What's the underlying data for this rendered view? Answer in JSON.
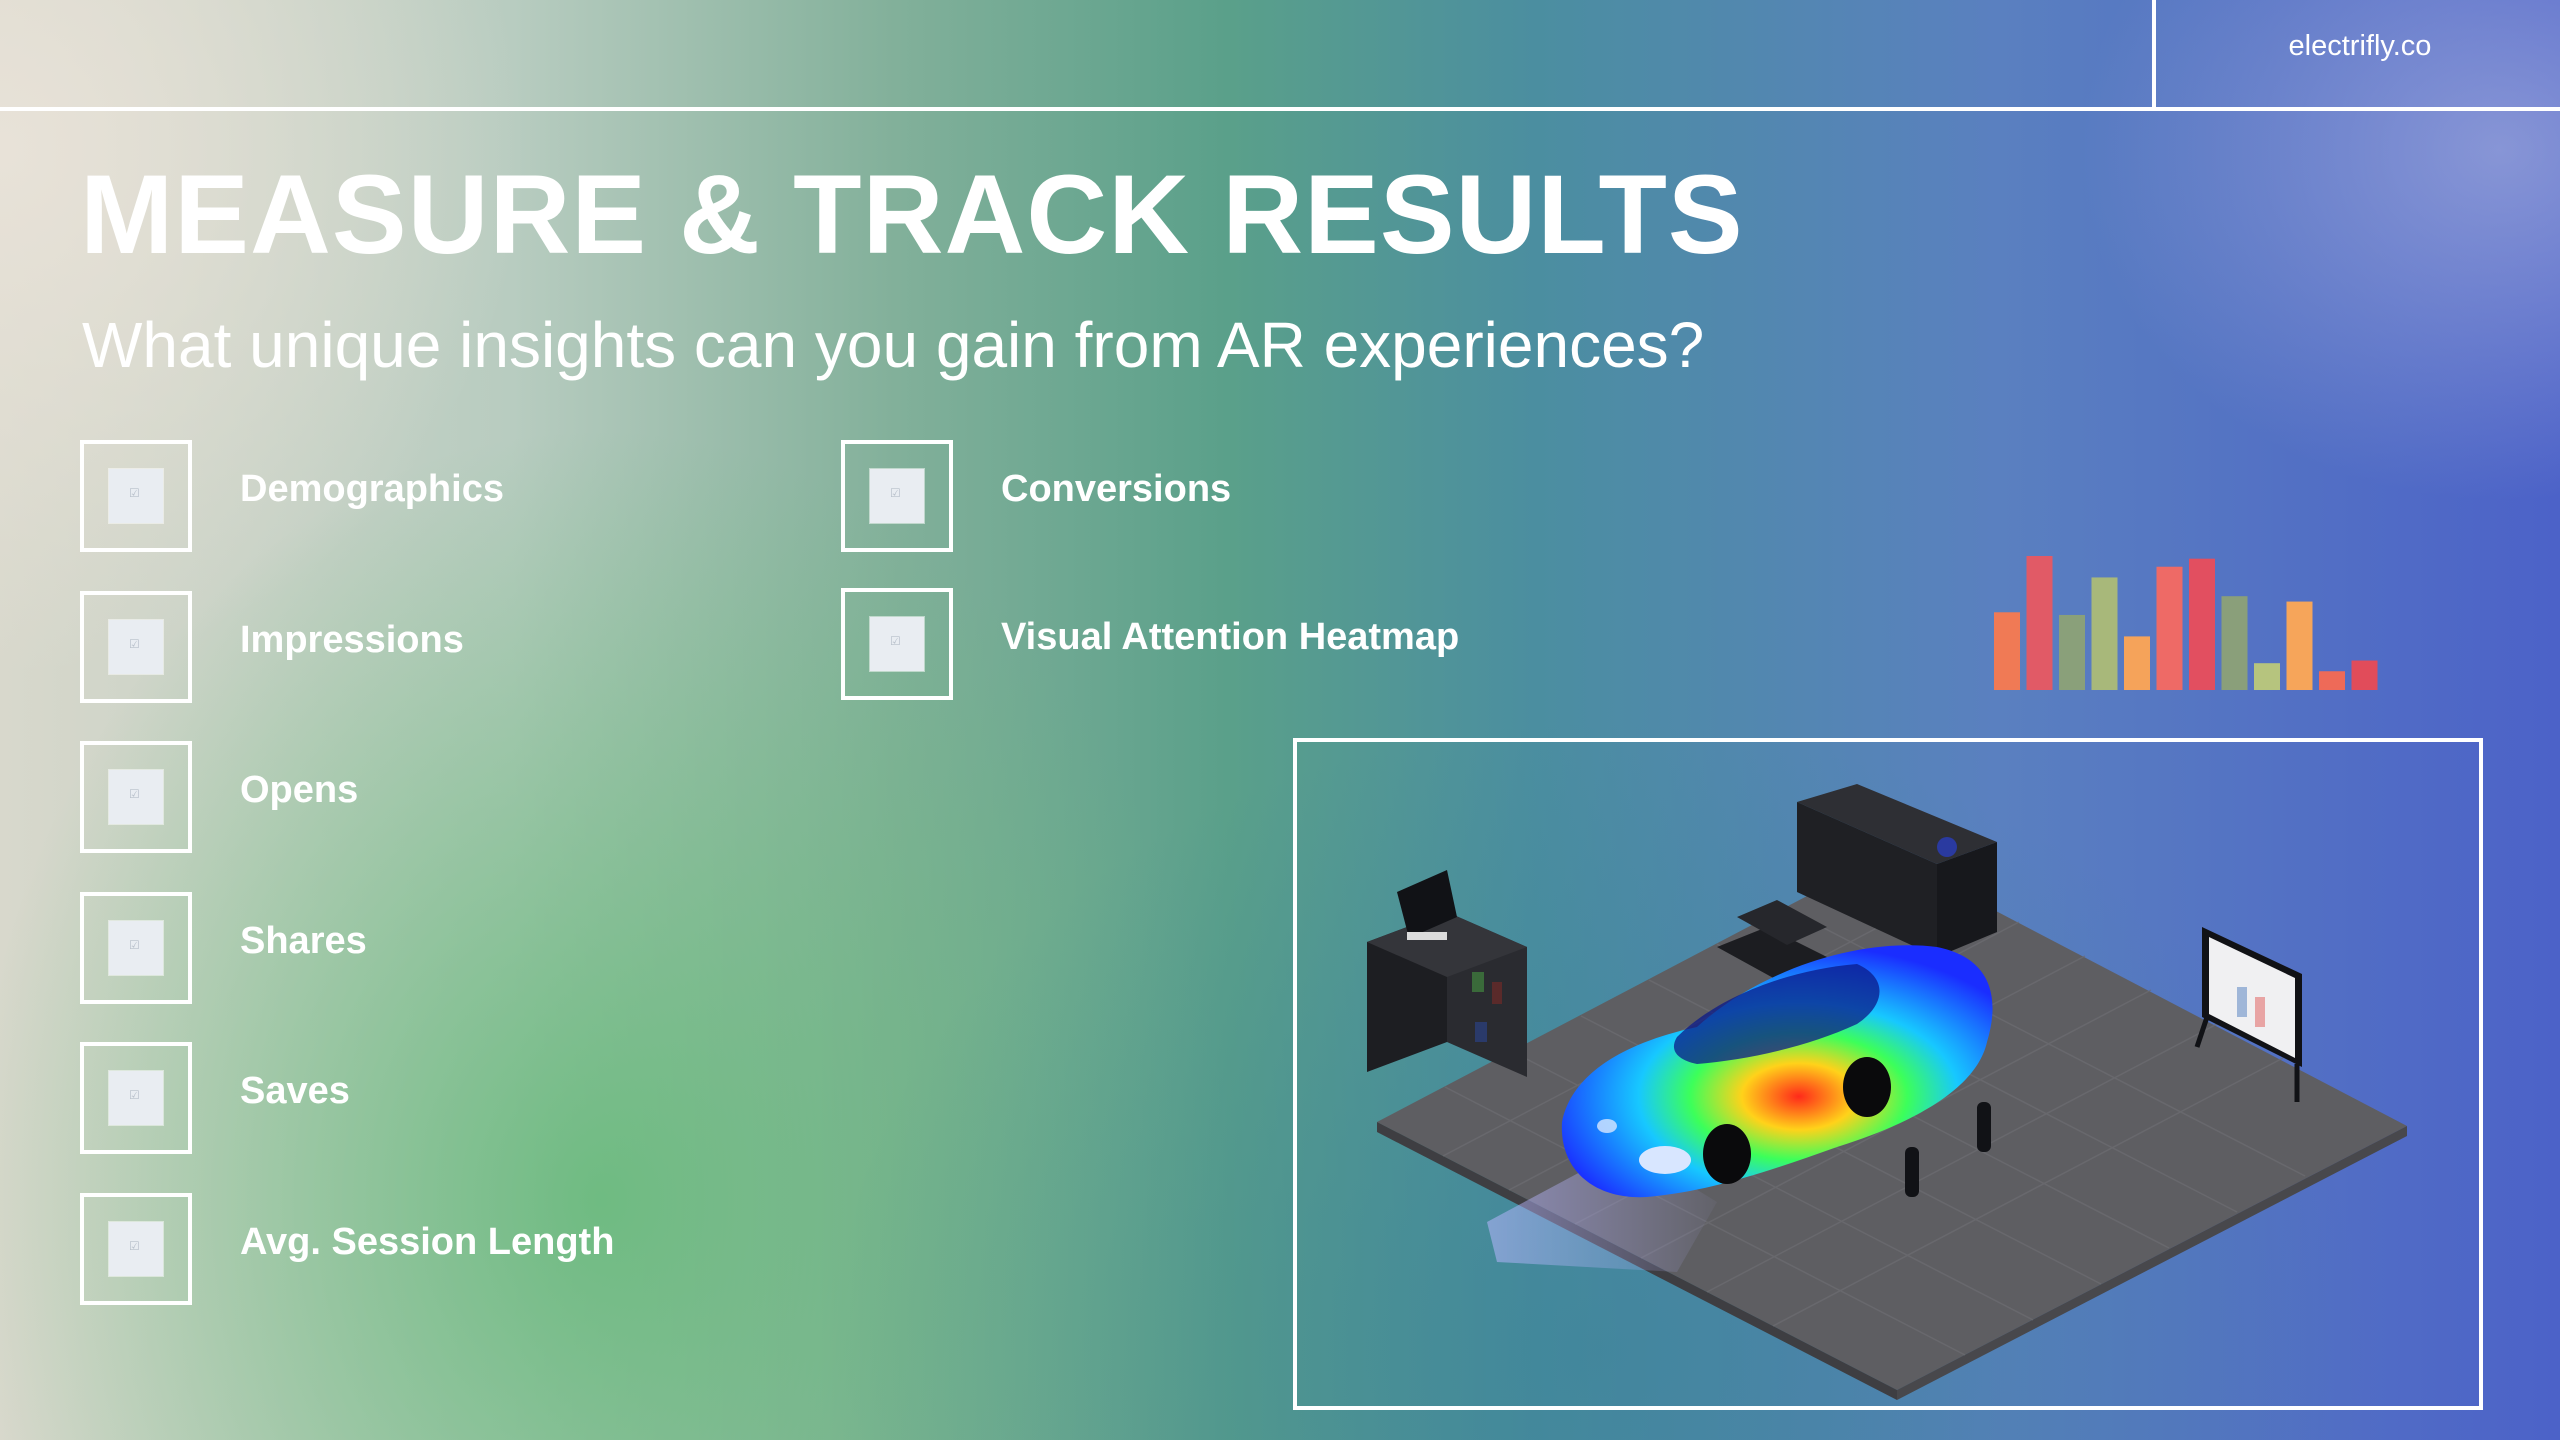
{
  "header": {
    "brand": "electrifly.co"
  },
  "title": "MEASURE & TRACK RESULTS",
  "subtitle": "What unique insights can you gain from AR experiences?",
  "metrics_left": [
    "Demographics",
    "Impressions",
    "Opens",
    "Shares",
    "Saves",
    "Avg. Session Length"
  ],
  "metrics_right": [
    "Conversions",
    "Visual Attention Heatmap"
  ],
  "icons": {
    "checkbox": "checkbox-icon",
    "bar_chart": "bar-chart-icon"
  },
  "decor_bars": {
    "heights": [
      0.58,
      1.0,
      0.56,
      0.84,
      0.4,
      0.92,
      0.98,
      0.7,
      0.2,
      0.66,
      0.14,
      0.22
    ],
    "colors": [
      "#f07a55",
      "#e15a66",
      "#8aa07a",
      "#a8b87a",
      "#f5a35a",
      "#ee6a66",
      "#e24f60",
      "#8a9f7a",
      "#b6c47e",
      "#f6a55a",
      "#ee6a58",
      "#e14c5a"
    ]
  },
  "colors": {
    "accent": "#ffffff",
    "floor": "#5c5c60",
    "car_blue": "#1e3cff"
  }
}
